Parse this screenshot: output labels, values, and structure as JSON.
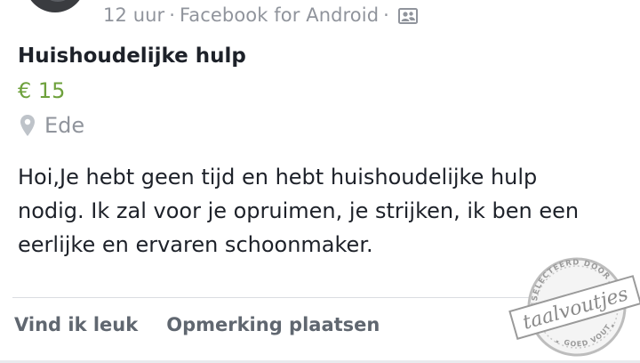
{
  "post": {
    "timestamp": "12 uur",
    "separator": "·",
    "source": "Facebook for Android",
    "audience_icon": "friends-icon",
    "title": "Huishoudelijke hulp",
    "price": "€ 15",
    "location_icon": "map-pin-icon",
    "location": "Ede",
    "body": "Hoi,Je hebt geen tijd en hebt huishoudelijke hulp nodig. Ik zal voor je opruimen, je strijken, ik ben een eerlijke en ervaren schoonmaker."
  },
  "actions": {
    "like_label": "Vind ik leuk",
    "comment_label": "Opmerking plaatsen"
  },
  "watermark": {
    "top_text": "GESELECTEERD DOOR",
    "brand": "taalvoutjes",
    "bottom_text": "GOED VOUT!"
  },
  "colors": {
    "price": "#6ea13c",
    "meta": "#90949c",
    "text": "#1d2129",
    "action": "#606770"
  }
}
